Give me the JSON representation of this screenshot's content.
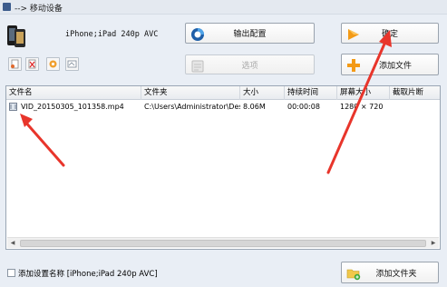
{
  "window": {
    "title": "--> 移动设备"
  },
  "device": {
    "label": "iPhone;iPad 240p AVC"
  },
  "buttons": {
    "output_config": "输出配置",
    "ok": "确定",
    "options": "选项",
    "add_file": "添加文件",
    "add_folder": "添加文件夹"
  },
  "table": {
    "columns": [
      "文件名",
      "文件夹",
      "大小",
      "持续时间",
      "屏幕大小",
      "截取片断"
    ],
    "rows": [
      {
        "name": "VID_20150305_101358.mp4",
        "folder": "C:\\Users\\Administrator\\Des...",
        "size": "8.06M",
        "duration": "00:00:08",
        "screen": "1280 × 720",
        "clip": ""
      }
    ]
  },
  "footer": {
    "checkbox_label": "添加设置名称 [iPhone;iPad 240p AVC]"
  },
  "colors": {
    "annotation_arrow": "#e8352b",
    "accent_orange": "#f39a16"
  }
}
